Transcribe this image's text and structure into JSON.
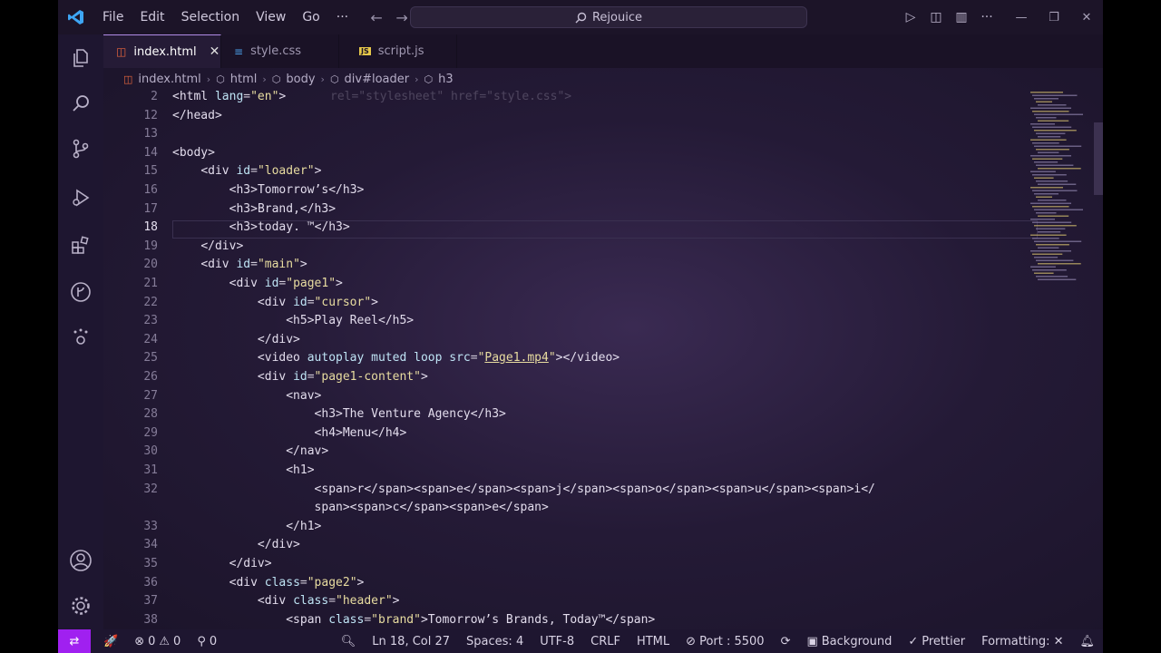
{
  "menu": [
    "File",
    "Edit",
    "Selection",
    "View",
    "Go",
    "···"
  ],
  "command_center": "Rejouice",
  "tabs": [
    {
      "label": "index.html",
      "icon": "html-file-icon",
      "active": true
    },
    {
      "label": "style.css",
      "icon": "css-file-icon",
      "active": false
    },
    {
      "label": "script.js",
      "icon": "js-file-icon",
      "active": false
    }
  ],
  "breadcrumb": [
    "index.html",
    "html",
    "body",
    "div#loader",
    "h3"
  ],
  "sticky_ghost": "rel=\"stylesheet\" href=\"style.css\">",
  "lines": [
    {
      "n": "2",
      "html": "<span class=t>&lt;html </span><span class=a>lang</span><span class=p>=</span><span class=s>\"en\"</span><span class=t>&gt;</span>"
    },
    {
      "n": "12",
      "html": "<span class=t>&lt;/head&gt;</span>"
    },
    {
      "n": "13",
      "html": ""
    },
    {
      "n": "14",
      "html": "<span class=t>&lt;body&gt;</span>"
    },
    {
      "n": "15",
      "html": "    <span class=t>&lt;div </span><span class=a>id</span><span class=p>=</span><span class=s>\"loader\"</span><span class=t>&gt;</span>"
    },
    {
      "n": "16",
      "html": "        <span class=t>&lt;h3&gt;</span>Tomorrow’s<span class=t>&lt;/h3&gt;</span>"
    },
    {
      "n": "17",
      "html": "        <span class=t>&lt;h3&gt;</span>Brand,<span class=t>&lt;/h3&gt;</span>"
    },
    {
      "n": "18",
      "html": "        <span class=t>&lt;h3&gt;</span>today. ™<span class=t>&lt;/h3&gt;</span>"
    },
    {
      "n": "19",
      "html": "    <span class=t>&lt;/div&gt;</span>"
    },
    {
      "n": "20",
      "html": "    <span class=t>&lt;div </span><span class=a>id</span><span class=p>=</span><span class=s>\"main\"</span><span class=t>&gt;</span>"
    },
    {
      "n": "21",
      "html": "        <span class=t>&lt;div </span><span class=a>id</span><span class=p>=</span><span class=s>\"page1\"</span><span class=t>&gt;</span>"
    },
    {
      "n": "22",
      "html": "            <span class=t>&lt;div </span><span class=a>id</span><span class=p>=</span><span class=s>\"cursor\"</span><span class=t>&gt;</span>"
    },
    {
      "n": "23",
      "html": "                <span class=t>&lt;h5&gt;</span>Play Reel<span class=t>&lt;/h5&gt;</span>"
    },
    {
      "n": "24",
      "html": "            <span class=t>&lt;/div&gt;</span>"
    },
    {
      "n": "25",
      "html": "            <span class=t>&lt;video </span><span class=a>autoplay muted loop src</span><span class=p>=</span><span class=s>\"<u>Page1.mp4</u>\"</span><span class=t>&gt;&lt;/video&gt;</span>"
    },
    {
      "n": "26",
      "html": "            <span class=t>&lt;div </span><span class=a>id</span><span class=p>=</span><span class=s>\"page1-content\"</span><span class=t>&gt;</span>"
    },
    {
      "n": "27",
      "html": "                <span class=t>&lt;nav&gt;</span>"
    },
    {
      "n": "28",
      "html": "                    <span class=t>&lt;h3&gt;</span>The Venture Agency<span class=t>&lt;/h3&gt;</span>"
    },
    {
      "n": "29",
      "html": "                    <span class=t>&lt;h4&gt;</span>Menu<span class=t>&lt;/h4&gt;</span>"
    },
    {
      "n": "30",
      "html": "                <span class=t>&lt;/nav&gt;</span>"
    },
    {
      "n": "31",
      "html": "                <span class=t>&lt;h1&gt;</span>"
    },
    {
      "n": "32",
      "html": "                    <span class=t>&lt;span&gt;</span>r<span class=t>&lt;/span&gt;&lt;span&gt;</span>e<span class=t>&lt;/span&gt;&lt;span&gt;</span>j<span class=t>&lt;/span&gt;&lt;span&gt;</span>o<span class=t>&lt;/span&gt;&lt;span&gt;</span>u<span class=t>&lt;/span&gt;&lt;span&gt;</span>i<span class=t>&lt;/</span>"
    },
    {
      "n": "",
      "html": "                    <span class=t>span&gt;&lt;span&gt;</span>c<span class=t>&lt;/span&gt;&lt;span&gt;</span>e<span class=t>&lt;/span&gt;</span>"
    },
    {
      "n": "33",
      "html": "                <span class=t>&lt;/h1&gt;</span>"
    },
    {
      "n": "34",
      "html": "            <span class=t>&lt;/div&gt;</span>"
    },
    {
      "n": "35",
      "html": "        <span class=t>&lt;/div&gt;</span>"
    },
    {
      "n": "36",
      "html": "        <span class=t>&lt;div </span><span class=a>class</span><span class=p>=</span><span class=s>\"page2\"</span><span class=t>&gt;</span>"
    },
    {
      "n": "37",
      "html": "            <span class=t>&lt;div </span><span class=a>class</span><span class=p>=</span><span class=s>\"header\"</span><span class=t>&gt;</span>"
    },
    {
      "n": "38",
      "html": "                <span class=t>&lt;span </span><span class=a>class</span><span class=p>=</span><span class=s>\"brand\"</span><span class=t>&gt;</span>Tomorrow’s Brands, Today™<span class=t>&lt;/span&gt;</span>"
    }
  ],
  "current_line": "18",
  "status": {
    "errors": "0",
    "warnings": "0",
    "ports": "0",
    "position": "Ln 18, Col 27",
    "spaces": "Spaces: 4",
    "encoding": "UTF-8",
    "eol": "CRLF",
    "language": "HTML",
    "live_server": "Port : 5500",
    "background": "Background",
    "prettier": "Prettier",
    "formatting": "Formatting: ✕"
  },
  "colors": {
    "accent": "#a020f0",
    "tab_border": "#b08be6"
  }
}
